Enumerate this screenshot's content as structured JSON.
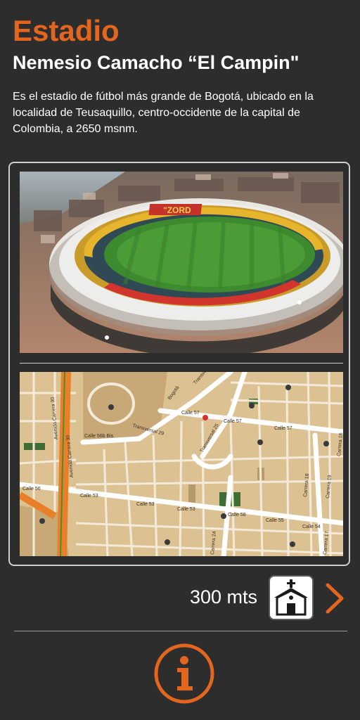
{
  "header": {
    "title": "Estadio",
    "subtitle": "Nemesio Camacho “El Campin\""
  },
  "description": "Es el estadio de fútbol más grande de Bogotá, ubicado en la localidad de Teusaquillo, centro-occidente de la capital de Colombia, a 2650 msnm.",
  "photo": {
    "stand_text": "\"ZORD"
  },
  "map": {
    "streets": {
      "calle57": "Calle 57",
      "calle57b": "Calle 57",
      "calle57c": "Calle 57",
      "calle56b": "Calle 56b Bis",
      "calle56": "Calle 56",
      "calle53a": "Calle 53",
      "calle53b": "Calle 53",
      "calle53c": "Calle 53",
      "calle53d": "Calle 53",
      "calle55": "Calle 55",
      "calle54": "Calle 54",
      "calle58": "Calle 58",
      "tv29": "Transversal 29",
      "tv25": "Transversal 25",
      "tv25b": "Transversal 25",
      "av_cra30": "Avenida Carrera 30",
      "av_cra30b": "Avenida Carrera 30",
      "cra24": "Carrera 24",
      "cra24b": "Avenida Carrera 24",
      "cra19": "Carrera 19",
      "cra17": "Carrera 17",
      "cra16": "Carrera 16",
      "cra18": "Carrera 18",
      "bogota": "Bogotá"
    }
  },
  "nav": {
    "distance": "300 mts",
    "place_icon": "church-icon",
    "next_icon": "chevron-right-icon",
    "info_icon": "info-icon"
  },
  "colors": {
    "accent": "#e2661d",
    "background": "#2d2d2d"
  }
}
